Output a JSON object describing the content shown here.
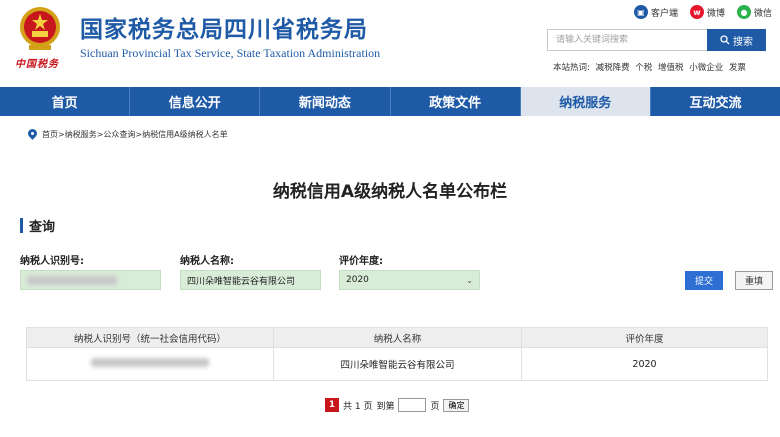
{
  "header": {
    "title": "国家税务总局四川省税务局",
    "subtitle": "Sichuan Provincial Tax Service, State Taxation Administration",
    "brand_sign": "中国税务",
    "quicklinks": [
      {
        "label": "客户端",
        "icon": "client-app-icon",
        "color": "#1f5aa6"
      },
      {
        "label": "微博",
        "icon": "weibo-icon",
        "color": "#e6162d"
      },
      {
        "label": "微信",
        "icon": "wechat-icon",
        "color": "#2bb24c"
      }
    ],
    "search_placeholder": "请输入关键词搜索",
    "search_button": "搜索",
    "hot_label": "本站热词:",
    "hot_words": [
      "减税降费",
      "个税",
      "增值税",
      "小微企业",
      "发票"
    ]
  },
  "nav": [
    {
      "label": "首页",
      "active": false
    },
    {
      "label": "信息公开",
      "active": false
    },
    {
      "label": "新闻动态",
      "active": false
    },
    {
      "label": "政策文件",
      "active": false
    },
    {
      "label": "纳税服务",
      "active": true
    },
    {
      "label": "互动交流",
      "active": false
    }
  ],
  "breadcrumb": "首页>纳税服务>公众查询>纳税信用A级纳税人名单",
  "page_heading": "纳税信用A级纳税人名单公布栏",
  "section_title": "查询",
  "form": {
    "taxpayer_id_label": "纳税人识别号:",
    "taxpayer_name_label": "纳税人名称:",
    "taxpayer_name_value": "四川朵唯智能云谷有限公司",
    "year_label": "评价年度:",
    "year_value": "2020",
    "submit_label": "提交",
    "reset_label": "重填"
  },
  "table": {
    "headers": [
      "纳税人识别号（统一社会信用代码）",
      "纳税人名称",
      "评价年度"
    ],
    "rows": [
      {
        "name": "四川朵唯智能云谷有限公司",
        "year": "2020"
      }
    ]
  },
  "pager": {
    "current_page": "1",
    "total_text": "共 1 页",
    "goto_text": "到第",
    "page_suffix": "页",
    "confirm_label": "确定"
  }
}
